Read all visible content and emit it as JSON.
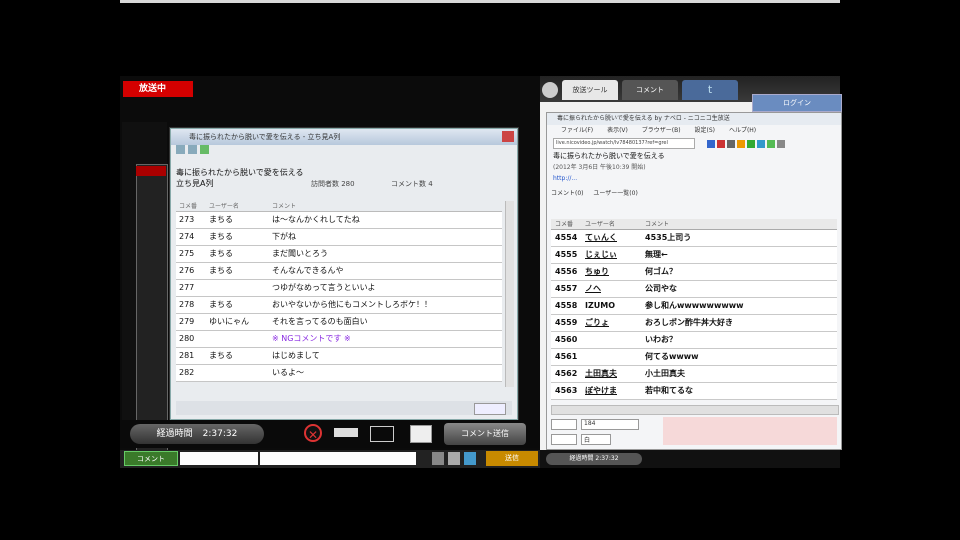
{
  "broadcaster": {
    "onair_label": "放送中",
    "player_window_title": "毒に振られたから脱いで愛を伝える - 立ち見A列",
    "broadcast_title": "毒に振られたから脱いで愛を伝える",
    "seat": "立ち見A列",
    "meta_visitors": "訪問者数 280",
    "meta_comments": "コメント数 4",
    "columns": {
      "no": "コメ番",
      "user": "ユーザー名",
      "comment": "コメント"
    },
    "comments": [
      {
        "no": "273",
        "user": "まちる",
        "text": "は～なんかくれしてたね"
      },
      {
        "no": "274",
        "user": "まちる",
        "text": "下がね"
      },
      {
        "no": "275",
        "user": "まちる",
        "text": "まだ聞いとろう"
      },
      {
        "no": "276",
        "user": "まちる",
        "text": "そんなんできるんや"
      },
      {
        "no": "277",
        "user": "",
        "text": "つゆがなめって言うといいよ"
      },
      {
        "no": "278",
        "user": "まちる",
        "text": "おいやないから他にもコメントしろボケ！！"
      },
      {
        "no": "279",
        "user": "ゆいにゃん",
        "text": "それを言ってるのも面白い"
      },
      {
        "no": "280",
        "user": "",
        "text": "※ NGコメントです ※",
        "ng": true
      },
      {
        "no": "281",
        "user": "まちる",
        "text": "はじめまして"
      },
      {
        "no": "282",
        "user": "",
        "text": "いるよ～"
      }
    ],
    "elapsed_label": "経過時間",
    "elapsed_time": "2:37:32",
    "send_button": "コメント送信",
    "chat_button": "コメント",
    "chat_button2": "送信"
  },
  "viewer": {
    "tabs": [
      "放送ツール",
      "コメント",
      "t"
    ],
    "popup_label": "ログイン",
    "window_title": "毒に振られたから脱いで愛を伝える by ナベロ - ニコニコ生放送",
    "menu": [
      "ファイル(F)",
      "表示(V)",
      "ブラウザー(B)",
      "設定(S)",
      "ヘルプ(H)"
    ],
    "url": "live.nicovideo.jp/watch/lv78480137?ref=grel",
    "title": "毒に振られたから脱いで愛を伝える",
    "sub_info": "(2012年 3月6日 午後10:39 開始)",
    "link": "http://...",
    "subtabs": [
      "コメント(0)",
      "ユーザー一覧(0)"
    ],
    "columns": {
      "no": "コメ番",
      "user": "ユーザー名",
      "comment": "コメント"
    },
    "comments": [
      {
        "no": "4554",
        "user": "てぃんく",
        "text": "4535上司う"
      },
      {
        "no": "4555",
        "user": "じぇじぃ",
        "text": "無理←"
      },
      {
        "no": "4556",
        "user": "ちゅり",
        "text": "何ゴム？"
      },
      {
        "no": "4557",
        "user": "ノヘ",
        "text": "公司やな"
      },
      {
        "no": "4558",
        "user": "IZUMO",
        "text": "参し和んwwwwwwwww"
      },
      {
        "no": "4559",
        "user": "ごりょ",
        "text": "おろしポン酢牛丼大好き"
      },
      {
        "no": "4560",
        "user": "",
        "text": "いわお？"
      },
      {
        "no": "4561",
        "user": "",
        "text": "何てるwwww"
      },
      {
        "no": "4562",
        "user": "土田真夫",
        "text": "小土田真夫"
      },
      {
        "no": "4563",
        "user": "ぼやけま",
        "text": "若中和てるな"
      }
    ],
    "form_label": "184",
    "form_color": "白",
    "elapsed_label": "経過時間",
    "elapsed_time": "2:37:32"
  }
}
